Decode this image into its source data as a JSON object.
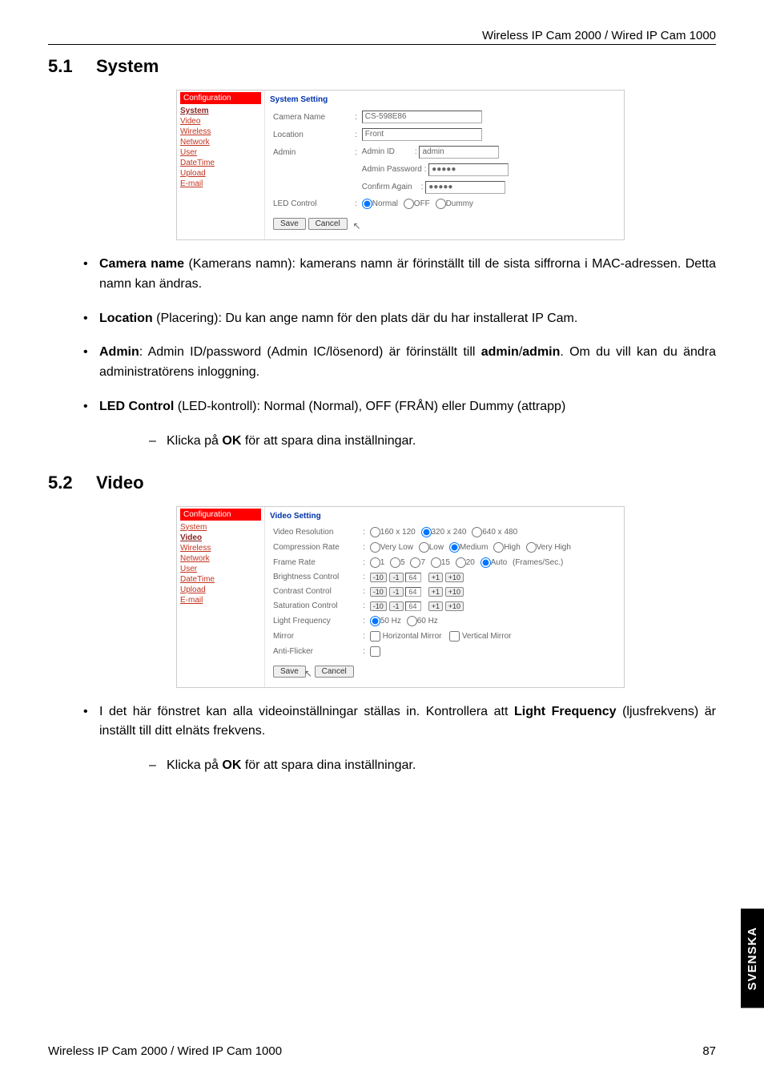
{
  "header": {
    "title": "Wireless IP Cam 2000 / Wired IP Cam 1000"
  },
  "sec51": {
    "num": "5.1",
    "title": "System"
  },
  "sec52": {
    "num": "5.2",
    "title": "Video"
  },
  "nav": {
    "header": "Configuration",
    "system": "System",
    "video": "Video",
    "wireless": "Wireless",
    "network": "Network",
    "user": "User",
    "datetime": "DateTime",
    "upload": "Upload",
    "email": "E-mail"
  },
  "sys": {
    "panel": "System Setting",
    "camera_name_lbl": "Camera Name",
    "camera_name_val": "CS-598E86",
    "location_lbl": "Location",
    "location_val": "Front",
    "admin_lbl": "Admin",
    "admin_id_lbl": "Admin ID",
    "admin_id_val": "admin",
    "admin_pw_lbl": "Admin Password",
    "admin_pw_val": "●●●●●",
    "confirm_lbl": "Confirm Again",
    "confirm_val": "●●●●●",
    "led_lbl": "LED Control",
    "led_normal": "Normal",
    "led_off": "OFF",
    "led_dummy": "Dummy",
    "save": "Save",
    "cancel": "Cancel"
  },
  "vid": {
    "panel": "Video Setting",
    "res_lbl": "Video Resolution",
    "res1": "160 x 120",
    "res2": "320 x 240",
    "res3": "640 x 480",
    "comp_lbl": "Compression Rate",
    "comp1": "Very Low",
    "comp2": "Low",
    "comp3": "Medium",
    "comp4": "High",
    "comp5": "Very High",
    "fr_lbl": "Frame Rate",
    "fr1": "1",
    "fr2": "5",
    "fr3": "7",
    "fr4": "15",
    "fr5": "20",
    "fr6": "Auto",
    "fr_unit": "(Frames/Sec.)",
    "bright_lbl": "Brightness Control",
    "contrast_lbl": "Contrast Control",
    "sat_lbl": "Saturation Control",
    "stepper": {
      "m10": "-10",
      "m1": "-1",
      "val": "64",
      "p1": "+1",
      "p10": "+10"
    },
    "lf_lbl": "Light Frequency",
    "lf1": "50 Hz",
    "lf2": "60 Hz",
    "mirror_lbl": "Mirror",
    "mirror_h": "Horizontal Mirror",
    "mirror_v": "Vertical Mirror",
    "af_lbl": "Anti-Flicker",
    "save": "Save",
    "cancel": "Cancel"
  },
  "text": {
    "b1a": "Camera name",
    "b1b": " (Kamerans namn): kamerans namn är förinställt till de sista siffrorna i MAC-adressen. Detta namn kan ändras.",
    "b2a": "Location",
    "b2b": " (Placering): Du kan ange namn för den plats där du har installerat IP Cam.",
    "b3a": "Admin",
    "b3b": ": Admin ID/password (Admin IC/lösenord) är förinställt till ",
    "b3c": "admin",
    "b3d": "/",
    "b3e": "admin",
    "b3f": ". Om du vill kan du ändra administratörens inloggning.",
    "b4a": "LED Control",
    "b4b": " (LED-kontroll): Normal (Normal), OFF (FRÅN) eller Dummy (attrapp)",
    "sub_ok_a": "Klicka på ",
    "sub_ok_b": "OK",
    "sub_ok_c": " för att spara dina inställningar.",
    "b5a": "I det här fönstret kan alla videoinställningar ställas in. Kontrollera att ",
    "b5b": "Light Frequency",
    "b5c": " (ljusfrekvens) är inställt till ditt elnäts frekvens."
  },
  "footer": {
    "left": "Wireless IP Cam 2000 / Wired IP Cam 1000",
    "page": "87"
  },
  "sidetab": "SVENSKA"
}
